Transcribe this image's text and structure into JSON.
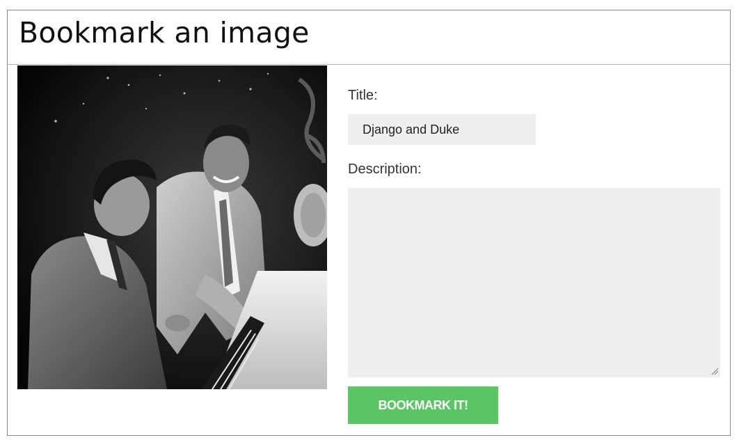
{
  "dialog": {
    "title": "Bookmark an image"
  },
  "photo": {
    "kind": "black-and-white photograph of two men at a piano"
  },
  "form": {
    "title_label": "Title:",
    "title_value": "Django and Duke",
    "description_label": "Description:",
    "description_value": "",
    "submit_label": "BOOKMARK IT!"
  },
  "colors": {
    "button": "#5bc464",
    "input_bg": "#eeeeee",
    "border": "#8a8a8a"
  }
}
